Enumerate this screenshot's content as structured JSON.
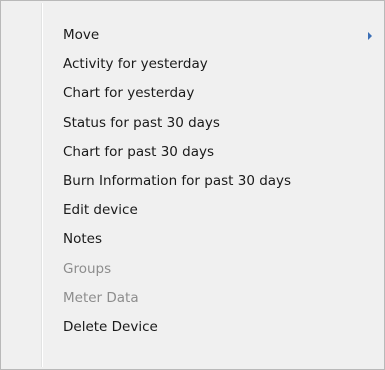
{
  "menu": {
    "items": [
      {
        "label": "Move",
        "has_submenu": true,
        "enabled": true
      },
      {
        "label": "Activity for yesterday",
        "has_submenu": false,
        "enabled": true
      },
      {
        "label": "Chart for yesterday",
        "has_submenu": false,
        "enabled": true
      },
      {
        "label": "Status for past 30 days",
        "has_submenu": false,
        "enabled": true
      },
      {
        "label": "Chart for past 30 days",
        "has_submenu": false,
        "enabled": true
      },
      {
        "label": "Burn Information for past 30 days",
        "has_submenu": false,
        "enabled": true
      },
      {
        "label": "Edit device",
        "has_submenu": false,
        "enabled": true
      },
      {
        "label": "Notes",
        "has_submenu": false,
        "enabled": true
      },
      {
        "label": "Groups",
        "has_submenu": false,
        "enabled": false
      },
      {
        "label": "Meter Data",
        "has_submenu": false,
        "enabled": false
      },
      {
        "label": "Delete Device",
        "has_submenu": false,
        "enabled": true
      }
    ],
    "submenu_arrow_icon": "chevron-right-icon",
    "colors": {
      "background": "#f0f0f0",
      "text": "#1a1a1a",
      "disabled_text": "#8d8d8d",
      "arrow": "#3b6fb6"
    }
  }
}
